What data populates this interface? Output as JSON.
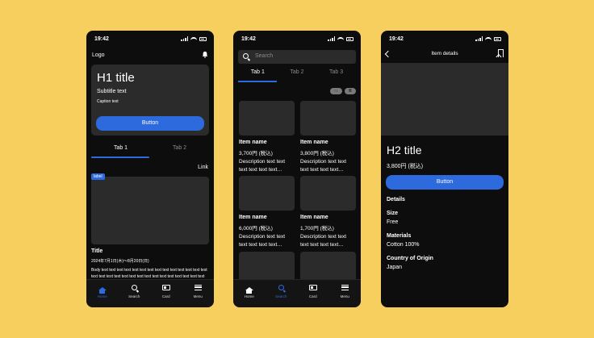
{
  "status": {
    "time": "19:42"
  },
  "screen1": {
    "logo": "Logo",
    "hero": {
      "title": "H1 title",
      "subtitle": "Subtitle text",
      "caption": "Caption text",
      "button": "Button"
    },
    "tabs": [
      "Tab 1",
      "Tab 2"
    ],
    "link": "Link",
    "card": {
      "label": "label",
      "title": "Title",
      "date": "2024年7月1日(木)〜8月20日(日)",
      "body": "Body text text text text text text text text text text text text text text text text text text text text text text text text text text text text text text text…"
    }
  },
  "screen2": {
    "search_placeholder": "Search",
    "tabs": [
      "Tab 1",
      "Tab 2",
      "Tab 3"
    ],
    "sort_pills": [
      "↑↓",
      "≣"
    ],
    "items": [
      {
        "name": "Item name",
        "price": "3,700円 (税込)",
        "desc": "Description text text text text text text…"
      },
      {
        "name": "Item name",
        "price": "3,800円 (税込)",
        "desc": "Description text text text text text text…"
      },
      {
        "name": "Item name",
        "price": "6,000円 (税込)",
        "desc": "Description text text text text text text…"
      },
      {
        "name": "Item name",
        "price": "1,700円 (税込)",
        "desc": "Description text text text text text text…"
      },
      {
        "name": "",
        "price": "",
        "desc": ""
      },
      {
        "name": "",
        "price": "",
        "desc": ""
      }
    ]
  },
  "screen3": {
    "header_title": "Item details",
    "title": "H2 title",
    "price": "3,800円 (税込)",
    "button": "Button",
    "details_heading": "Details",
    "details": [
      {
        "label": "Size",
        "value": "Free"
      },
      {
        "label": "Materials",
        "value": "Cotton 100%"
      },
      {
        "label": "Country of Origin",
        "value": "Japan"
      }
    ]
  },
  "tabbar": [
    "Home",
    "Search",
    "Card",
    "Menu"
  ],
  "colors": {
    "background": "#f6cf5f",
    "phone": "#0d0d0d",
    "surface": "#2b2b2b",
    "accent": "#2d6ade"
  }
}
